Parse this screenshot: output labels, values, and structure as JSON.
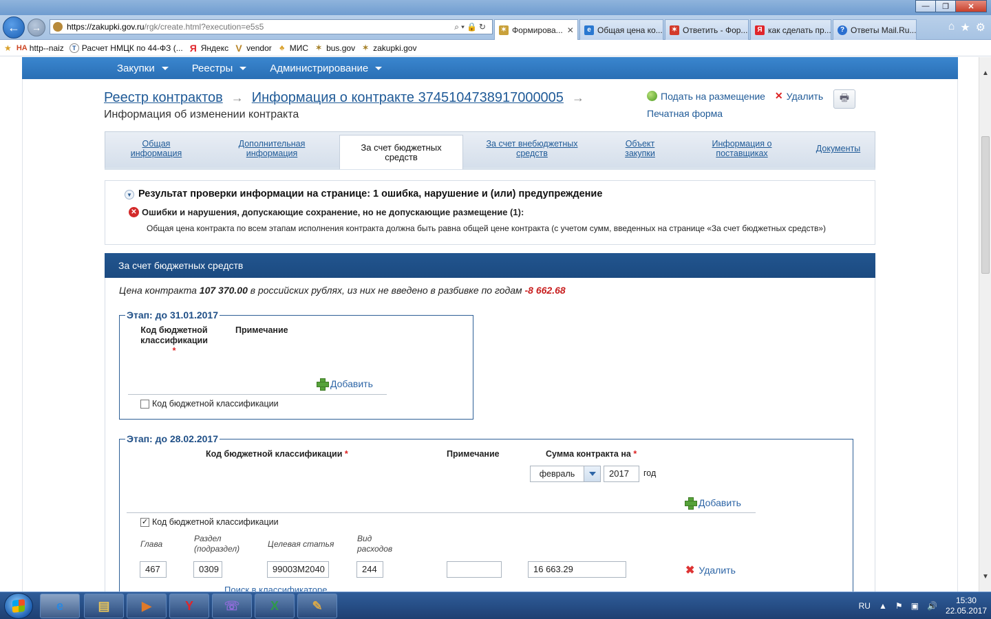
{
  "browser": {
    "url_host": "https://zakupki.gov.ru",
    "url_path": "/rgk/create.html?execution=e5s5",
    "tabs": [
      {
        "label": "Формирова...",
        "active": true
      },
      {
        "label": "Общая цена ко...",
        "active": false
      },
      {
        "label": "Ответить - Фор...",
        "active": false
      },
      {
        "label": "как сделать пр...",
        "active": false
      },
      {
        "label": "Ответы Mail.Ru...",
        "active": false
      }
    ],
    "favorites": [
      {
        "label": "http--naiz",
        "icon": "naiz-icon"
      },
      {
        "label": "Расчет НМЦК по 44-ФЗ (...",
        "icon": "t-icon"
      },
      {
        "label": "Яндекс",
        "icon": "yandex-icon"
      },
      {
        "label": "vendor",
        "icon": "vendor-icon"
      },
      {
        "label": "МИС",
        "icon": "mis-icon"
      },
      {
        "label": "bus.gov",
        "icon": "emblem-icon"
      },
      {
        "label": "zakupki.gov",
        "icon": "emblem-icon"
      }
    ]
  },
  "menu": {
    "items": [
      {
        "label": "Закупки"
      },
      {
        "label": "Реестры"
      },
      {
        "label": "Администрирование"
      }
    ]
  },
  "header": {
    "crumb_registry": "Реестр контрактов",
    "crumb_contract": "Информация о контракте 3745104738917000005",
    "subtitle": "Информация об изменении контракта",
    "submit_label": "Подать на размещение",
    "delete_label": "Удалить",
    "print_form_label": "Печатная форма"
  },
  "tabs": [
    {
      "line1": "Общая",
      "line2": "информация",
      "active": false
    },
    {
      "line1": "Дополнительная",
      "line2": "информация",
      "active": false
    },
    {
      "line1": "За счет бюджетных",
      "line2": "средств",
      "active": true
    },
    {
      "line1": "За счет внебюджетных",
      "line2": "средств",
      "active": false
    },
    {
      "line1": "Объект",
      "line2": "закупки",
      "active": false
    },
    {
      "line1": "Информация о",
      "line2": "поставщиках",
      "active": false
    },
    {
      "line1": "Документы",
      "line2": "",
      "active": false
    }
  ],
  "validation": {
    "title": "Результат проверки информации на странице: 1 ошибка, нарушение и (или) предупреждение",
    "error_header": "Ошибки и нарушения, допускающие сохранение, но не допускающие размещение (1):",
    "error_detail": "Общая цена контракта по всем этапам исполнения контракта должна быть равна общей цене контракта (с учетом сумм, введенных на странице «За счет бюджетных средств»)"
  },
  "section": {
    "title": "За счет бюджетных средств",
    "price_prefix": "Цена контракта",
    "price_value": "107 370.00",
    "price_middle": "в российских рублях, из них не введено в разбивке по годам",
    "price_missing": "-8 662.68"
  },
  "stage1": {
    "legend": "Этап: до 31.01.2017",
    "col_kbk": "Код бюджетной классификации",
    "col_note": "Примечание",
    "add_label": "Добавить",
    "checkbox_label": "Код бюджетной классификации",
    "checked": false
  },
  "stage2": {
    "legend": "Этап: до 28.02.2017",
    "col_kbk": "Код бюджетной классификации",
    "col_note": "Примечание",
    "col_sum": "Сумма контракта на",
    "month": "февраль",
    "year": "2017",
    "year_suffix": "год",
    "add_label": "Добавить",
    "checkbox_label": "Код бюджетной классификации",
    "checked": true,
    "sub_chapter": "Глава",
    "sub_section": "Раздел (подраздел)",
    "sub_target": "Целевая статья",
    "sub_expense": "Вид расходов",
    "chapter": "467",
    "section_code": "0309",
    "target": "99003М2040",
    "expense": "244",
    "note": "",
    "amount": "16 663.29",
    "delete_label": "Удалить",
    "classifier_link": "Поиск в классификаторе"
  },
  "taskbar": {
    "lang": "RU",
    "time": "15:30",
    "date": "22.05.2017"
  }
}
